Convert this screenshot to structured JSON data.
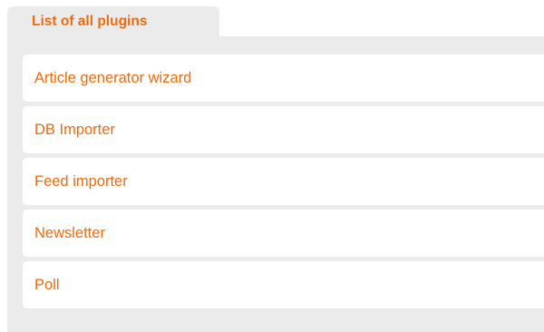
{
  "tab": {
    "label": "List of all plugins"
  },
  "plugins": [
    {
      "label": "Article generator wizard"
    },
    {
      "label": "DB Importer"
    },
    {
      "label": "Feed importer"
    },
    {
      "label": "Newsletter"
    },
    {
      "label": "Poll"
    }
  ],
  "colors": {
    "accent": "#ef6b0c",
    "panel_bg": "#ebebeb",
    "item_bg": "#ffffff"
  }
}
